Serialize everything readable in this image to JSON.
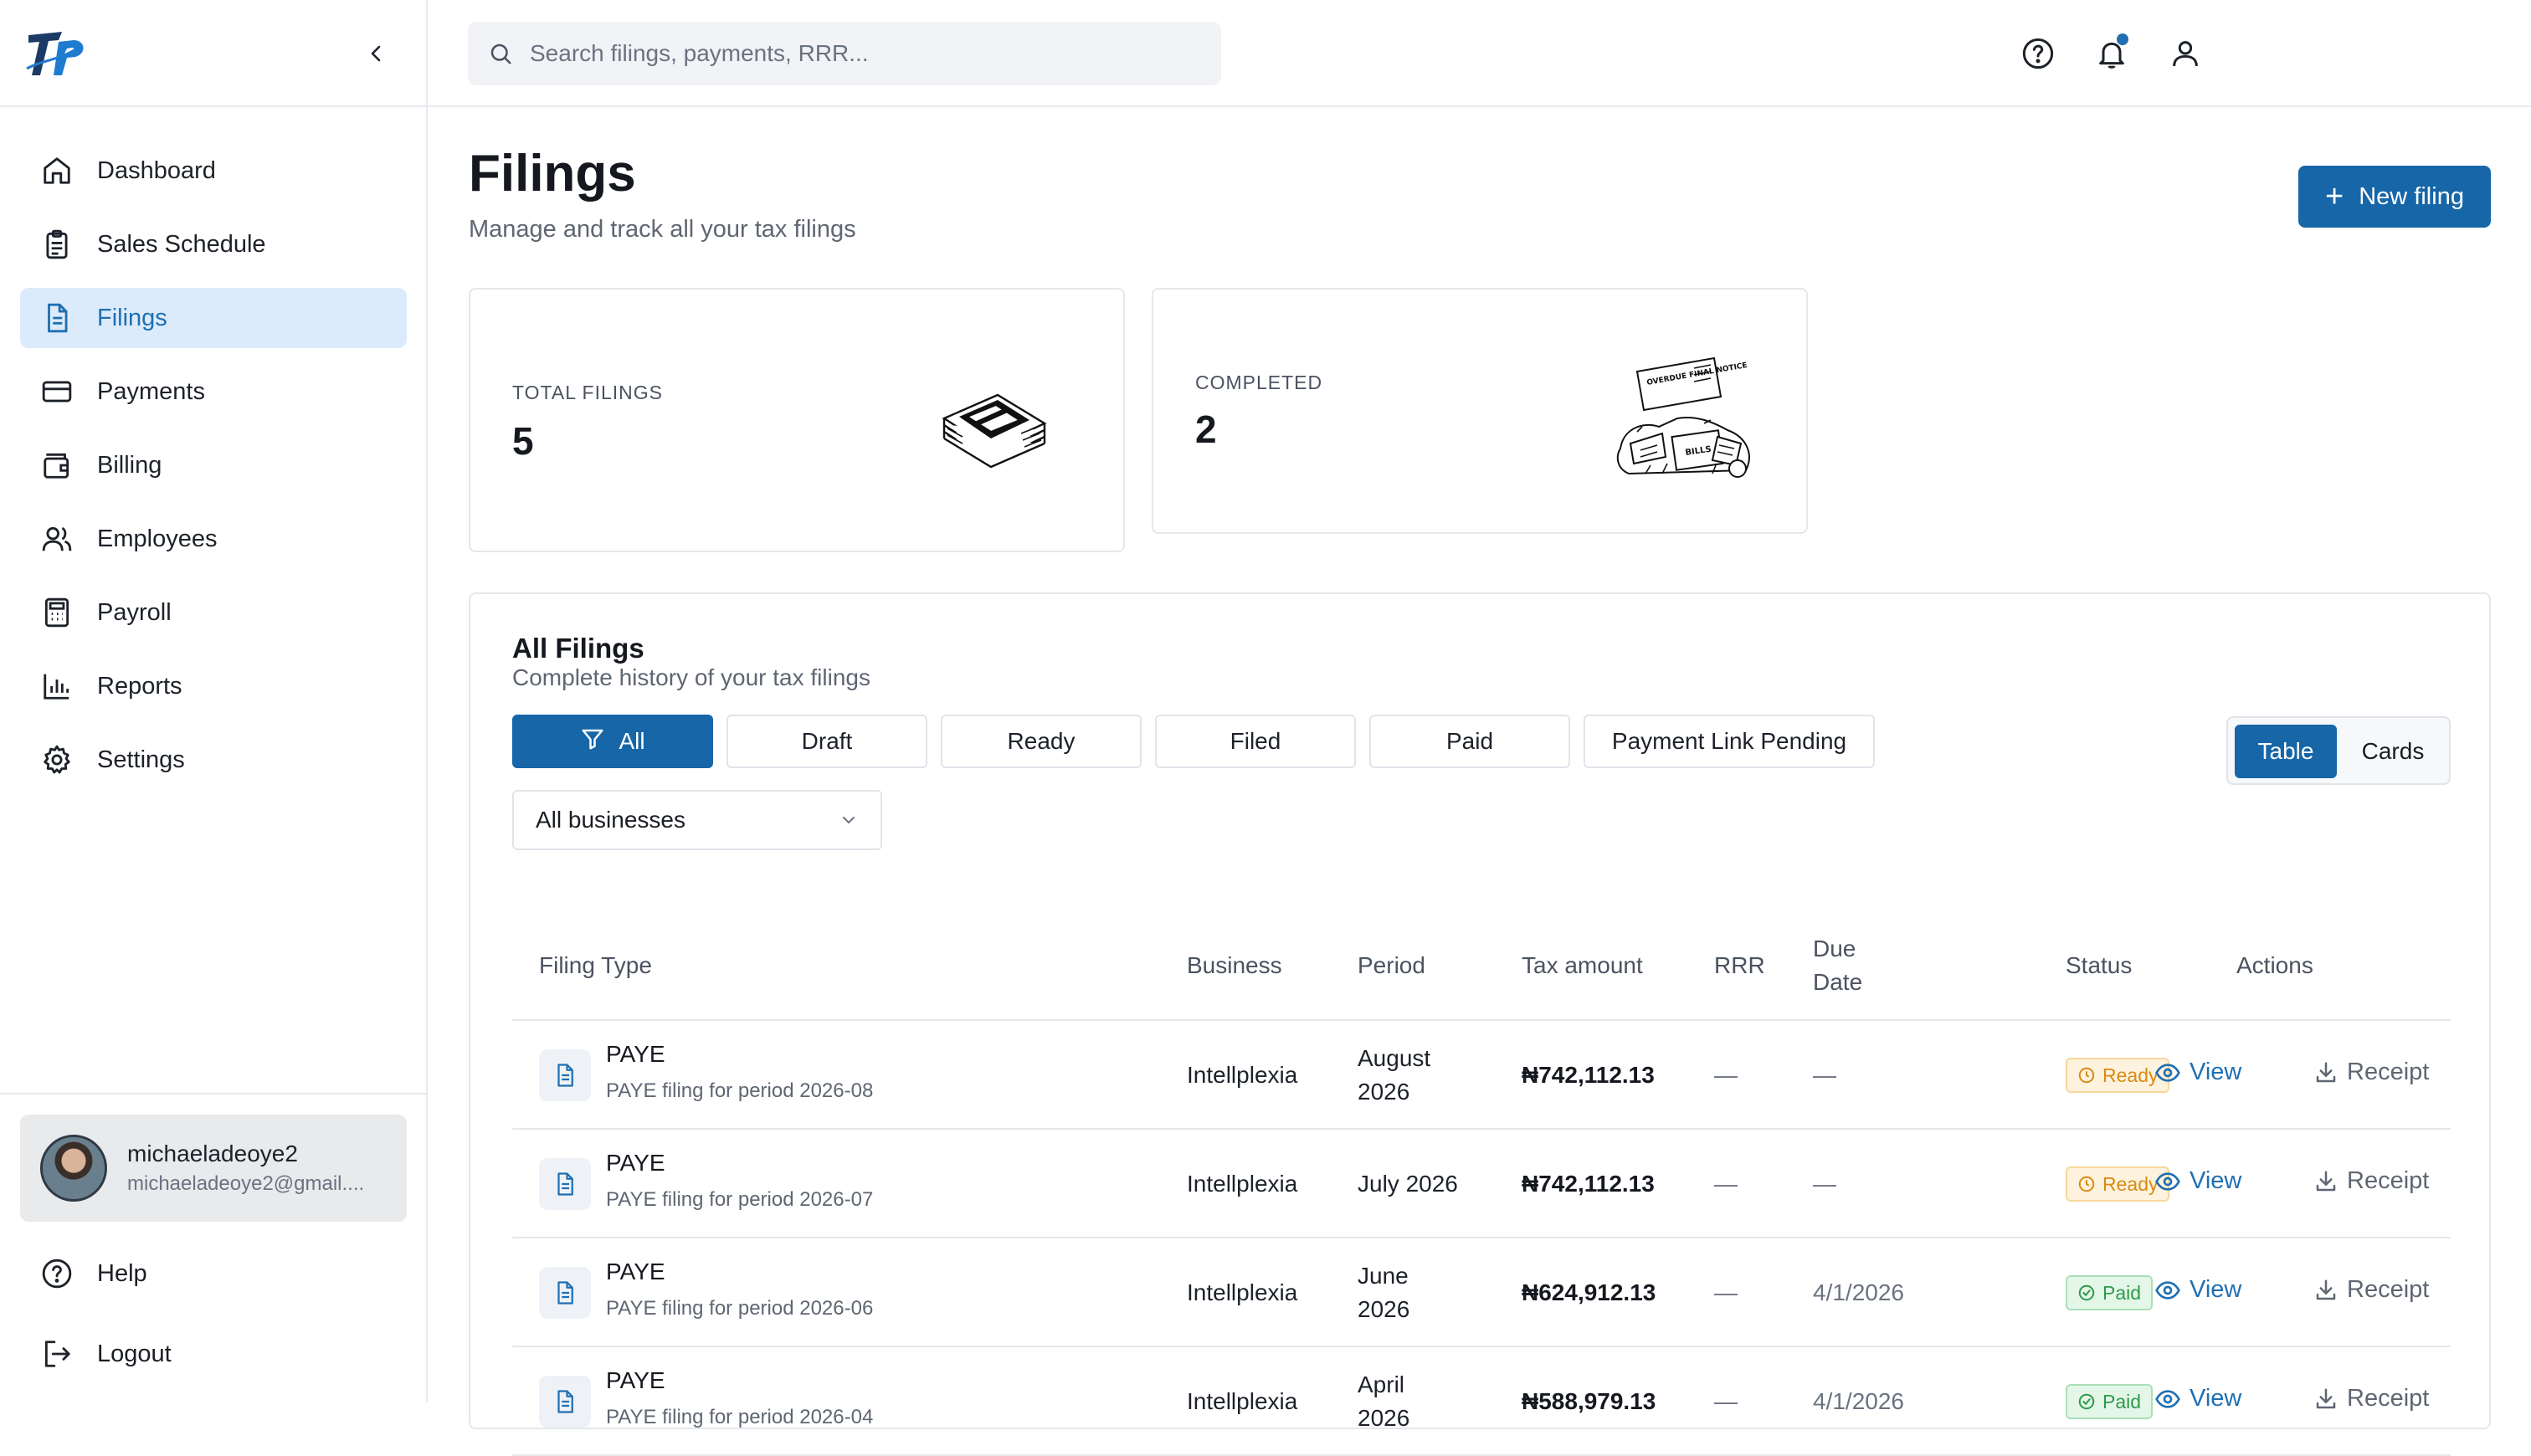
{
  "sidebar": {
    "items": [
      {
        "label": "Dashboard",
        "icon": "home-icon"
      },
      {
        "label": "Sales Schedule",
        "icon": "clipboard-icon"
      },
      {
        "label": "Filings",
        "icon": "file-text-icon",
        "active": true
      },
      {
        "label": "Payments",
        "icon": "credit-card-icon"
      },
      {
        "label": "Billing",
        "icon": "wallet-icon"
      },
      {
        "label": "Employees",
        "icon": "users-icon"
      },
      {
        "label": "Payroll",
        "icon": "calculator-icon"
      },
      {
        "label": "Reports",
        "icon": "bar-chart-icon"
      },
      {
        "label": "Settings",
        "icon": "gear-icon"
      }
    ],
    "user": {
      "name": "michaeladeoye2",
      "email": "michaeladeoye2@gmail...."
    },
    "help_label": "Help",
    "logout_label": "Logout"
  },
  "search": {
    "placeholder": "Search filings, payments, RRR..."
  },
  "header": {
    "title": "Filings",
    "subtitle": "Manage and track all your tax filings",
    "new_button_label": "New filing"
  },
  "stats": {
    "total_label": "TOTAL FILINGS",
    "total_value": "5",
    "completed_label": "COMPLETED",
    "completed_value": "2",
    "overdue_text": "OVERDUE FINAL NOTICE",
    "bills_text": "BILLS"
  },
  "all_filings": {
    "title": "All Filings",
    "subtitle": "Complete history of your tax filings",
    "filters": [
      "All",
      "Draft",
      "Ready",
      "Filed",
      "Paid",
      "Payment Link Pending"
    ],
    "active_filter": "All",
    "view_toggle": [
      "Table",
      "Cards"
    ],
    "active_view": "Table",
    "business_select": "All businesses",
    "columns": [
      "Filing Type",
      "Business",
      "Period",
      "Tax amount",
      "RRR",
      "Due Date",
      "Status",
      "Actions"
    ],
    "view_label": "View",
    "receipt_label": "Receipt",
    "rows": [
      {
        "type": "PAYE",
        "desc": "PAYE filing for period 2026-08",
        "business": "Intellplexia",
        "period": "August 2026",
        "amount": "₦742,112.13",
        "rrr": "—",
        "due": "—",
        "status": "Ready"
      },
      {
        "type": "PAYE",
        "desc": "PAYE filing for period 2026-07",
        "business": "Intellplexia",
        "period": "July 2026",
        "amount": "₦742,112.13",
        "rrr": "—",
        "due": "—",
        "status": "Ready"
      },
      {
        "type": "PAYE",
        "desc": "PAYE filing for period 2026-06",
        "business": "Intellplexia",
        "period": "June 2026",
        "amount": "₦624,912.13",
        "rrr": "—",
        "due": "4/1/2026",
        "status": "Paid"
      },
      {
        "type": "PAYE",
        "desc": "PAYE filing for period 2026-04",
        "business": "Intellplexia",
        "period": "April 2026",
        "amount": "₦588,979.13",
        "rrr": "—",
        "due": "4/1/2026",
        "status": "Paid"
      }
    ]
  },
  "colors": {
    "accent": "#1666a8",
    "active_nav_bg": "#dcebfb",
    "ready": "#d98b14",
    "paid": "#2f9a4c"
  }
}
